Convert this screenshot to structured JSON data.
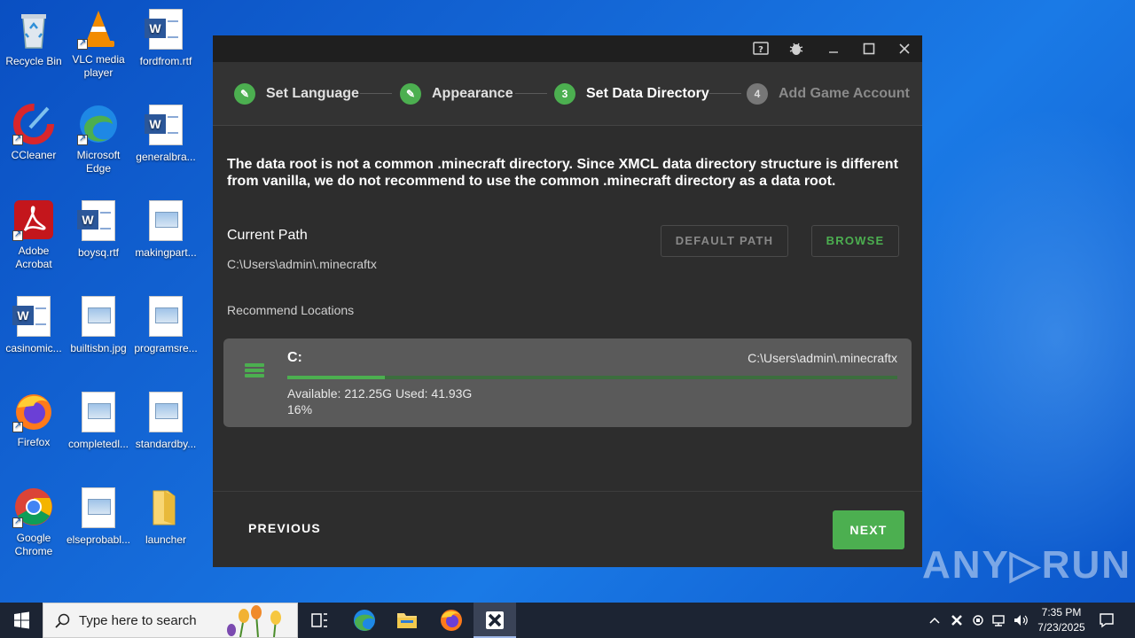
{
  "desktop": {
    "icons": [
      {
        "label": "Recycle Bin"
      },
      {
        "label": "VLC media player"
      },
      {
        "label": "fordfrom.rtf"
      },
      {
        "label": "CCleaner"
      },
      {
        "label": "Microsoft Edge"
      },
      {
        "label": "generalbra..."
      },
      {
        "label": "Adobe Acrobat"
      },
      {
        "label": "boysq.rtf"
      },
      {
        "label": "makingpart..."
      },
      {
        "label": "casinomic..."
      },
      {
        "label": "builtisbn.jpg"
      },
      {
        "label": "programsre..."
      },
      {
        "label": "Firefox"
      },
      {
        "label": "completedl..."
      },
      {
        "label": "standardby..."
      },
      {
        "label": "Google Chrome"
      },
      {
        "label": "elseprobabl..."
      },
      {
        "label": "launcher"
      }
    ]
  },
  "window": {
    "titlebar_icons": [
      "help-icon",
      "bug-icon",
      "minimize-icon",
      "maximize-icon",
      "close-icon"
    ],
    "steps": [
      {
        "label": "Set Language",
        "state": "done",
        "marker": "✎"
      },
      {
        "label": "Appearance",
        "state": "done",
        "marker": "✎"
      },
      {
        "label": "Set Data Directory",
        "state": "active",
        "marker": "3"
      },
      {
        "label": "Add Game Account",
        "state": "todo",
        "marker": "4"
      }
    ],
    "warning": "The data root is not a common .minecraft directory. Since XMCL data directory structure is different from vanilla, we do not recommend to use the common .minecraft directory as a data root.",
    "current_path_title": "Current Path",
    "current_path_value": "C:\\Users\\admin\\.minecraftx",
    "default_path_button": "DEFAULT PATH",
    "browse_button": "BROWSE",
    "recommend_title": "Recommend Locations",
    "drive": {
      "letter": "C:",
      "path": "C:\\Users\\admin\\.minecraftx",
      "usage_fraction": 0.16,
      "available_text": "Available: 212.25G Used: 41.93G",
      "percent_text": "16%"
    },
    "previous_button": "PREVIOUS",
    "next_button": "NEXT"
  },
  "watermark": "ANY▷RUN",
  "taskbar": {
    "search_placeholder": "Type here to search",
    "time": "7:35 PM",
    "date": "7/23/2025"
  },
  "colors": {
    "accent": "#4caf50",
    "window_bg": "#2d2d2d",
    "card_bg": "#5a5a5a"
  }
}
